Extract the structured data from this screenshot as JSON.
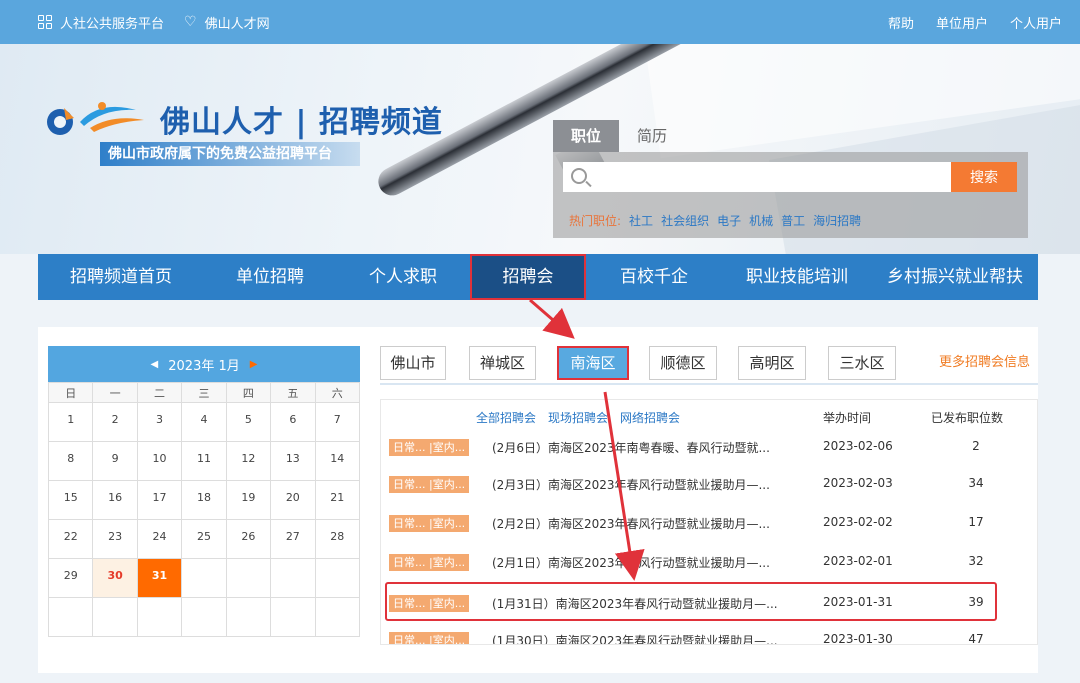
{
  "topbar": {
    "left_items": [
      "人社公共服务平台",
      "佛山人才网"
    ],
    "right_items": [
      "帮助",
      "单位用户",
      "个人用户"
    ]
  },
  "brand": {
    "title": "佛山人才 | 招聘频道",
    "subtitle": "佛山市政府属下的免费公益招聘平台"
  },
  "search": {
    "tabs": [
      "职位",
      "简历"
    ],
    "placeholder": "",
    "button": "搜索",
    "hot_label": "热门职位:",
    "hot_items": [
      "社工",
      "社会组织",
      "电子",
      "机械",
      "普工",
      "海归招聘"
    ]
  },
  "nav": {
    "items": [
      "招聘频道首页",
      "单位招聘",
      "个人求职",
      "招聘会",
      "百校千企",
      "职业技能培训",
      "乡村振兴就业帮扶"
    ],
    "active_index": 3
  },
  "calendar": {
    "month_label": "2023年 1月",
    "weekdays": [
      "日",
      "一",
      "二",
      "三",
      "四",
      "五",
      "六"
    ],
    "today": 30,
    "selected": 31
  },
  "districts": {
    "items": [
      "佛山市",
      "禅城区",
      "南海区",
      "顺德区",
      "高明区",
      "三水区"
    ],
    "active_index": 2,
    "more": "更多招聘会信息"
  },
  "fairs": {
    "filters": [
      "全部招聘会",
      "现场招聘会",
      "网络招聘会"
    ],
    "col_time": "举办时间",
    "col_count": "已发布职位数",
    "tag_text": "日常... |室内...",
    "rows": [
      {
        "title": "(2月6日）南海区2023年南粤春暖、春风行动暨就...",
        "date": "2023-02-06",
        "count": "2"
      },
      {
        "title": "(2月3日）南海区2023年春风行动暨就业援助月—...",
        "date": "2023-02-03",
        "count": "34"
      },
      {
        "title": "(2月2日）南海区2023年春风行动暨就业援助月—...",
        "date": "2023-02-02",
        "count": "17"
      },
      {
        "title": "(2月1日）南海区2023年春风行动暨就业援助月—...",
        "date": "2023-02-01",
        "count": "32"
      },
      {
        "title": "(1月31日）南海区2023年春风行动暨就业援助月—...",
        "date": "2023-01-31",
        "count": "39"
      },
      {
        "title": "(1月30日）南海区2023年春风行动暨就业援助月—...",
        "date": "2023-01-30",
        "count": "47"
      }
    ],
    "highlight_index": 4
  },
  "colors": {
    "topbar": "#5aa6dd",
    "nav": "#2d7fc7",
    "accent_orange": "#f47a33",
    "highlight_red": "#e0323a"
  }
}
